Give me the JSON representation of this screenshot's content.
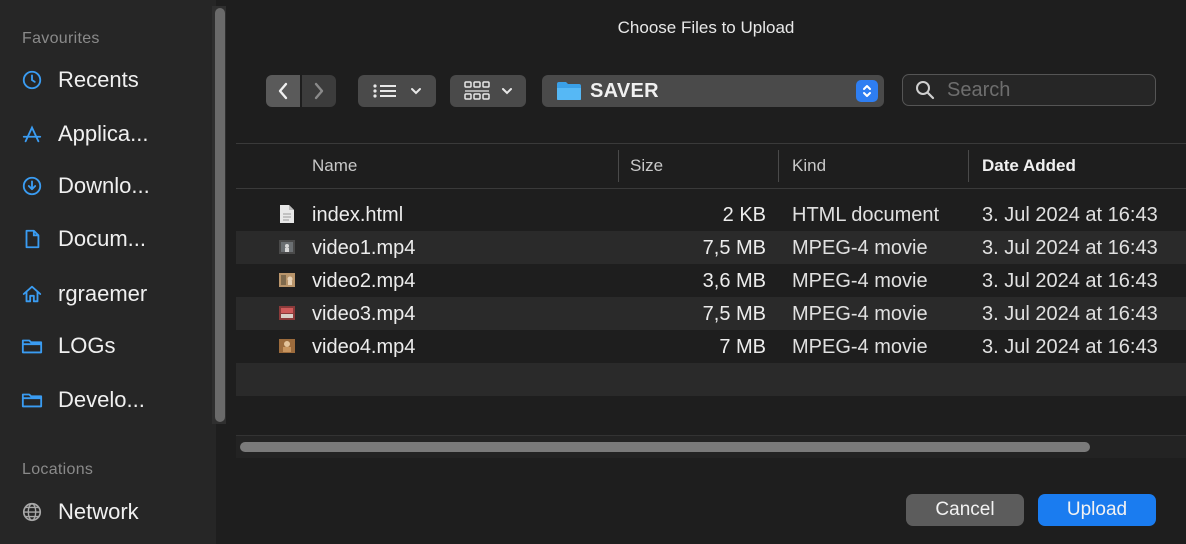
{
  "dialog": {
    "title": "Choose Files to Upload"
  },
  "sidebar": {
    "favourites_title": "Favourites",
    "favourites": [
      {
        "label": "Recents",
        "icon": "clock-icon"
      },
      {
        "label": "Applica...",
        "icon": "applications-icon"
      },
      {
        "label": "Downlo...",
        "icon": "download-icon"
      },
      {
        "label": "Docum...",
        "icon": "document-icon"
      },
      {
        "label": "rgraemer",
        "icon": "home-icon"
      },
      {
        "label": "LOGs",
        "icon": "folder-icon"
      },
      {
        "label": "Develo...",
        "icon": "folder-icon"
      }
    ],
    "locations_title": "Locations",
    "locations": [
      {
        "label": "Network",
        "icon": "globe-icon"
      }
    ]
  },
  "toolbar": {
    "location": "SAVER",
    "search_placeholder": "Search"
  },
  "table": {
    "columns": [
      "Name",
      "Size",
      "Kind",
      "Date Added"
    ],
    "rows": [
      {
        "name": "index.html",
        "size": "2 KB",
        "kind": "HTML document",
        "date": "3. Jul 2024 at 16:43",
        "icon": "html-file-icon"
      },
      {
        "name": "video1.mp4",
        "size": "7,5 MB",
        "kind": "MPEG-4 movie",
        "date": "3. Jul 2024 at 16:43",
        "icon": "video-thumbnail-icon"
      },
      {
        "name": "video2.mp4",
        "size": "3,6 MB",
        "kind": "MPEG-4 movie",
        "date": "3. Jul 2024 at 16:43",
        "icon": "video-thumbnail-icon"
      },
      {
        "name": "video3.mp4",
        "size": "7,5 MB",
        "kind": "MPEG-4 movie",
        "date": "3. Jul 2024 at 16:43",
        "icon": "video-thumbnail-icon"
      },
      {
        "name": "video4.mp4",
        "size": "7 MB",
        "kind": "MPEG-4 movie",
        "date": "3. Jul 2024 at 16:43",
        "icon": "video-thumbnail-icon"
      }
    ]
  },
  "buttons": {
    "cancel": "Cancel",
    "upload": "Upload"
  },
  "colors": {
    "accent": "#1a7cf0",
    "folder": "#3aa0e8",
    "background": "#1e1e1e",
    "sidebar": "#262626"
  }
}
